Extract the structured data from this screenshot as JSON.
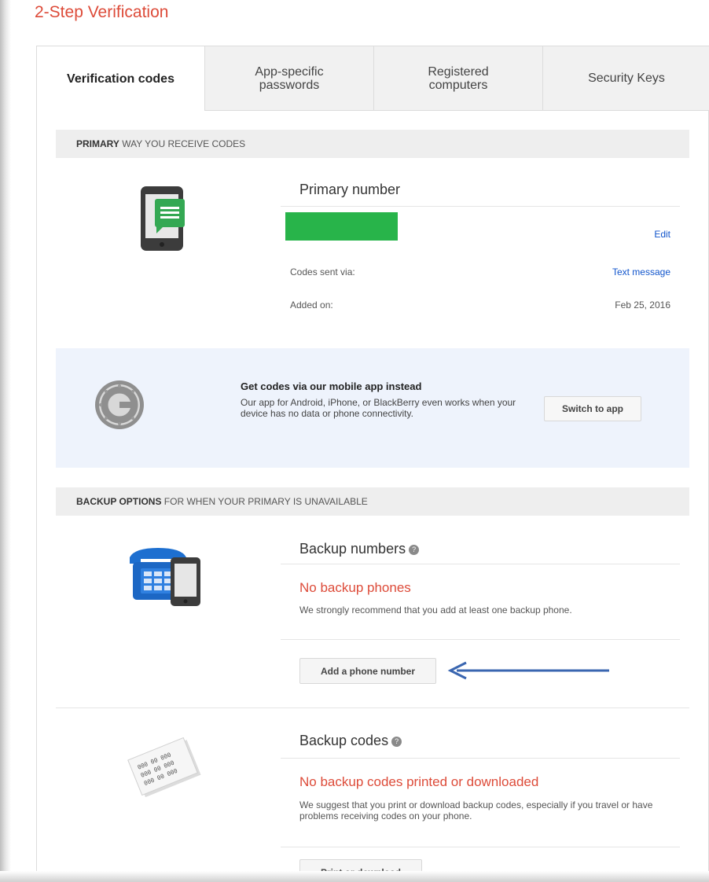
{
  "page": {
    "title": "2-Step Verification"
  },
  "tabs": [
    {
      "label": "Verification codes",
      "active": true
    },
    {
      "label": "App-specific\npasswords",
      "active": false
    },
    {
      "label": "Registered\ncomputers",
      "active": false
    },
    {
      "label": "Security Keys",
      "active": false
    }
  ],
  "primary_section": {
    "header_bold": "PRIMARY",
    "header_rest": " WAY YOU RECEIVE CODES",
    "title": "Primary number",
    "edit_label": "Edit",
    "codes_sent_label": "Codes sent via:",
    "codes_sent_value": "Text message",
    "added_label": "Added on:",
    "added_value": "Feb 25, 2016",
    "redaction_color": "#28b44a"
  },
  "app_promo": {
    "title": "Get codes via our mobile app instead",
    "description": "Our app for Android, iPhone, or BlackBerry even works when your device has no data or phone connectivity.",
    "button_label": "Switch to app"
  },
  "backup_section": {
    "header_bold": "BACKUP OPTIONS",
    "header_rest": " FOR WHEN YOUR PRIMARY IS UNAVAILABLE",
    "numbers_title": "Backup numbers",
    "numbers_warning": "No backup phones",
    "numbers_desc": "We strongly recommend that you add at least one backup phone.",
    "add_phone_label": "Add a phone number",
    "codes_title": "Backup codes",
    "codes_warning": "No backup codes printed or downloaded",
    "codes_desc": "We suggest that you print or download backup codes, especially if you travel or have problems receiving codes on your phone.",
    "print_label": "Print or download",
    "codes_paper_lines": [
      "000 00 000",
      "000 00 000",
      "000 00 000"
    ]
  },
  "colors": {
    "title_red": "#dd4b39",
    "link_blue": "#1155cc",
    "arrow_blue": "#3a66b0",
    "promo_bg": "#eef3fc"
  }
}
